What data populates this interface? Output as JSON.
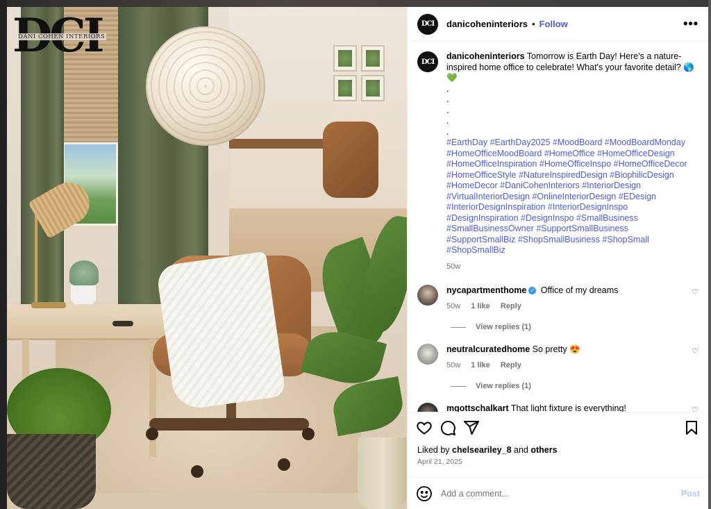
{
  "brand": {
    "logo_letters": "DCI",
    "logo_tagline": "DANI COHEN INTERIORS"
  },
  "header": {
    "username": "danicoheninteriors",
    "separator": "•",
    "follow_label": "Follow",
    "more_label": "•••"
  },
  "caption": {
    "username": "danicoheninteriors",
    "text": "Tomorrow is Earth Day! Here's a nature-inspired home office to celebrate! What's your favorite detail? 🌎💚",
    "dots": [
      ".",
      ".",
      ".",
      ".",
      "."
    ],
    "hashtags": "#EarthDay #EarthDay2025 #MoodBoard #MoodBoardMonday #HomeOfficeMoodBoard #HomeOffice #HomeOfficeDesign #HomeOfficeInspiration #HomeOfficeInspo #HomeOfficeDecor #HomeOfficeStyle #NatureInspiredDesign #BiophilicDesign #HomeDecor #DaniCohenInteriors #InteriorDesign #VirtualInteriorDesign #OnlineInteriorDesign #EDesign #InteriorDesignInspiration #InteriorDesignInspo #DesignInspiration #DesignInspo #SmallBusiness #SmallBusinessOwner #SupportSmallBusiness #SupportSmallBiz #ShopSmallBusiness #ShopSmall #ShopSmallBiz",
    "age": "50w"
  },
  "comments": [
    {
      "username": "nycapartmenthome",
      "verified": true,
      "text": "Office of my dreams",
      "age": "50w",
      "likes": "1 like",
      "reply_label": "Reply",
      "view_replies": "View replies (1)",
      "avatar_color": "#6b5b55"
    },
    {
      "username": "neutralcuratedhome",
      "verified": false,
      "text": "So pretty 😍",
      "age": "50w",
      "likes": "1 like",
      "reply_label": "Reply",
      "view_replies": "View replies (1)",
      "avatar_color": "#9a9a92"
    },
    {
      "username": "mgottschalkart",
      "verified": false,
      "text": "That light fixture is everything!",
      "avatar_color": "#2e2a28"
    }
  ],
  "actions": {
    "like_icon": "heart-icon",
    "comment_icon": "comment-icon",
    "share_icon": "share-icon",
    "save_icon": "bookmark-icon"
  },
  "likes": {
    "prefix": "Liked by",
    "user": "chelseariley_8",
    "conjunction": "and",
    "others": "others"
  },
  "date": "April 21, 2025",
  "add_comment": {
    "placeholder": "Add a comment...",
    "post_label": "Post"
  },
  "colors": {
    "link_blue": "#4a5bd4",
    "muted": "#737373",
    "post_disabled": "#b2c8f5",
    "verified": "#3897f0"
  }
}
